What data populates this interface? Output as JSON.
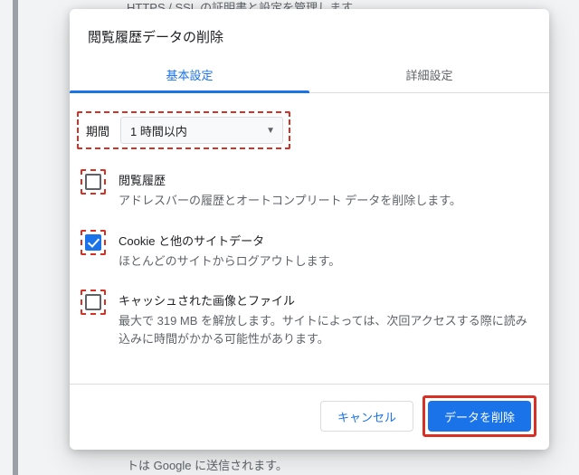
{
  "bg": {
    "top_text": "HTTPS / SSL の証明書と設定を管理します",
    "bottom_text": "トは Google に送信されます。"
  },
  "dialog": {
    "title": "閲覧履歴データの削除",
    "tabs": {
      "basic": "基本設定",
      "advanced": "詳細設定"
    },
    "period": {
      "label": "期間",
      "value": "1 時間以内"
    },
    "opts": {
      "history": {
        "title": "閲覧履歴",
        "desc": "アドレスバーの履歴とオートコンプリート データを削除します。"
      },
      "cookies": {
        "title": "Cookie と他のサイトデータ",
        "desc": "ほとんどのサイトからログアウトします。"
      },
      "cache": {
        "title": "キャッシュされた画像とファイル",
        "desc": "最大で 319 MB を解放します。サイトによっては、次回アクセスする際に読み込みに時間がかかる可能性があります。"
      }
    },
    "buttons": {
      "cancel": "キャンセル",
      "clear": "データを削除"
    }
  }
}
